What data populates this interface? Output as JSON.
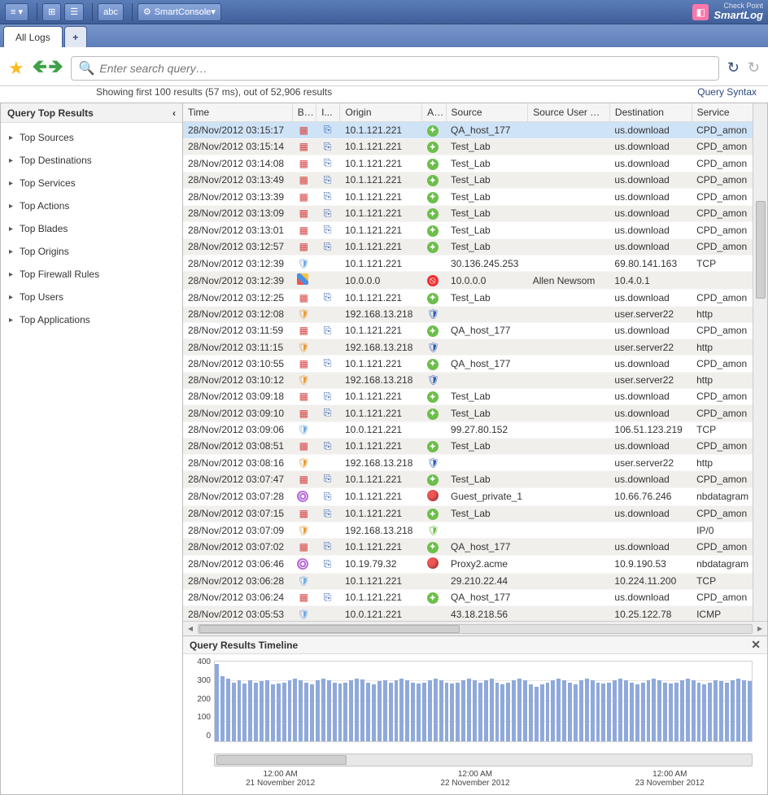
{
  "brand": {
    "top": "Check Point",
    "name": "SmartLog"
  },
  "ribbon": {
    "smartconsole": "SmartConsole",
    "abc": "abc"
  },
  "tabs": {
    "main": "All Logs"
  },
  "search": {
    "placeholder": "Enter search query…"
  },
  "status": {
    "text": "Showing first 100 results (57 ms), out of 52,906 results",
    "syntax": "Query Syntax"
  },
  "left": {
    "header": "Query Top Results",
    "items": [
      "Top Sources",
      "Top Destinations",
      "Top Services",
      "Top Actions",
      "Top Blades",
      "Top Origins",
      "Top Firewall Rules",
      "Top Users",
      "Top Applications"
    ]
  },
  "columns": [
    "Time",
    "B...",
    "I...",
    "Origin",
    "A...",
    "Source",
    "Source User N...",
    "Destination",
    "Service"
  ],
  "rows": [
    {
      "t": "28/Nov/2012 03:15:17",
      "b": "red",
      "i": "log",
      "o": "10.1.121.221",
      "a": "green",
      "s": "QA_host_177",
      "u": "",
      "d": "us.download",
      "v": "CPD_amon",
      "sel": true
    },
    {
      "t": "28/Nov/2012 03:15:14",
      "b": "red",
      "i": "log",
      "o": "10.1.121.221",
      "a": "green",
      "s": "Test_Lab",
      "u": "",
      "d": "us.download",
      "v": "CPD_amon"
    },
    {
      "t": "28/Nov/2012 03:14:08",
      "b": "red",
      "i": "log",
      "o": "10.1.121.221",
      "a": "green",
      "s": "Test_Lab",
      "u": "",
      "d": "us.download",
      "v": "CPD_amon"
    },
    {
      "t": "28/Nov/2012 03:13:49",
      "b": "red",
      "i": "log",
      "o": "10.1.121.221",
      "a": "green",
      "s": "Test_Lab",
      "u": "",
      "d": "us.download",
      "v": "CPD_amon"
    },
    {
      "t": "28/Nov/2012 03:13:39",
      "b": "red",
      "i": "log",
      "o": "10.1.121.221",
      "a": "green",
      "s": "Test_Lab",
      "u": "",
      "d": "us.download",
      "v": "CPD_amon"
    },
    {
      "t": "28/Nov/2012 03:13:09",
      "b": "red",
      "i": "log",
      "o": "10.1.121.221",
      "a": "green",
      "s": "Test_Lab",
      "u": "",
      "d": "us.download",
      "v": "CPD_amon"
    },
    {
      "t": "28/Nov/2012 03:13:01",
      "b": "red",
      "i": "log",
      "o": "10.1.121.221",
      "a": "green",
      "s": "Test_Lab",
      "u": "",
      "d": "us.download",
      "v": "CPD_amon"
    },
    {
      "t": "28/Nov/2012 03:12:57",
      "b": "red",
      "i": "log",
      "o": "10.1.121.221",
      "a": "green",
      "s": "Test_Lab",
      "u": "",
      "d": "us.download",
      "v": "CPD_amon"
    },
    {
      "t": "28/Nov/2012 03:12:39",
      "b": "sh-be",
      "i": "",
      "o": "10.1.121.221",
      "a": "",
      "s": "30.136.245.253",
      "u": "",
      "d": "69.80.141.163",
      "v": "TCP"
    },
    {
      "t": "28/Nov/2012 03:12:39",
      "b": "mix",
      "i": "",
      "o": "10.0.0.0",
      "a": "stop",
      "s": "10.0.0.0",
      "u": "Allen Newsom",
      "d": "10.4.0.1",
      "v": ""
    },
    {
      "t": "28/Nov/2012 03:12:25",
      "b": "red",
      "i": "log",
      "o": "10.1.121.221",
      "a": "green",
      "s": "Test_Lab",
      "u": "",
      "d": "us.download",
      "v": "CPD_amon"
    },
    {
      "t": "28/Nov/2012 03:12:08",
      "b": "sh-o",
      "i": "",
      "o": "192.168.13.218",
      "a": "sh-b",
      "s": "",
      "u": "",
      "d": "user.server22",
      "v": "http"
    },
    {
      "t": "28/Nov/2012 03:11:59",
      "b": "red",
      "i": "log",
      "o": "10.1.121.221",
      "a": "green",
      "s": "QA_host_177",
      "u": "",
      "d": "us.download",
      "v": "CPD_amon"
    },
    {
      "t": "28/Nov/2012 03:11:15",
      "b": "sh-o",
      "i": "",
      "o": "192.168.13.218",
      "a": "sh-b",
      "s": "",
      "u": "",
      "d": "user.server22",
      "v": "http"
    },
    {
      "t": "28/Nov/2012 03:10:55",
      "b": "red",
      "i": "log",
      "o": "10.1.121.221",
      "a": "green",
      "s": "QA_host_177",
      "u": "",
      "d": "us.download",
      "v": "CPD_amon"
    },
    {
      "t": "28/Nov/2012 03:10:12",
      "b": "sh-o",
      "i": "",
      "o": "192.168.13.218",
      "a": "sh-b",
      "s": "",
      "u": "",
      "d": "user.server22",
      "v": "http"
    },
    {
      "t": "28/Nov/2012 03:09:18",
      "b": "red",
      "i": "log",
      "o": "10.1.121.221",
      "a": "green",
      "s": "Test_Lab",
      "u": "",
      "d": "us.download",
      "v": "CPD_amon"
    },
    {
      "t": "28/Nov/2012 03:09:10",
      "b": "red",
      "i": "log",
      "o": "10.1.121.221",
      "a": "green",
      "s": "Test_Lab",
      "u": "",
      "d": "us.download",
      "v": "CPD_amon"
    },
    {
      "t": "28/Nov/2012 03:09:06",
      "b": "sh-be",
      "i": "",
      "o": "10.0.121.221",
      "a": "",
      "s": "99.27.80.152",
      "u": "",
      "d": "106.51.123.219",
      "v": "TCP"
    },
    {
      "t": "28/Nov/2012 03:08:51",
      "b": "red",
      "i": "log",
      "o": "10.1.121.221",
      "a": "green",
      "s": "Test_Lab",
      "u": "",
      "d": "us.download",
      "v": "CPD_amon"
    },
    {
      "t": "28/Nov/2012 03:08:16",
      "b": "sh-o",
      "i": "",
      "o": "192.168.13.218",
      "a": "sh-b",
      "s": "",
      "u": "",
      "d": "user.server22",
      "v": "http"
    },
    {
      "t": "28/Nov/2012 03:07:47",
      "b": "red",
      "i": "log",
      "o": "10.1.121.221",
      "a": "green",
      "s": "Test_Lab",
      "u": "",
      "d": "us.download",
      "v": "CPD_amon"
    },
    {
      "t": "28/Nov/2012 03:07:28",
      "b": "purp",
      "i": "log",
      "o": "10.1.121.221",
      "a": "redc",
      "s": "Guest_private_1",
      "u": "",
      "d": "10.66.76.246",
      "v": "nbdatagram"
    },
    {
      "t": "28/Nov/2012 03:07:15",
      "b": "red",
      "i": "log",
      "o": "10.1.121.221",
      "a": "green",
      "s": "Test_Lab",
      "u": "",
      "d": "us.download",
      "v": "CPD_amon"
    },
    {
      "t": "28/Nov/2012 03:07:09",
      "b": "sh-o",
      "i": "",
      "o": "192.168.13.218",
      "a": "sh-g",
      "s": "",
      "u": "",
      "d": "",
      "v": "IP/0"
    },
    {
      "t": "28/Nov/2012 03:07:02",
      "b": "red",
      "i": "log",
      "o": "10.1.121.221",
      "a": "green",
      "s": "QA_host_177",
      "u": "",
      "d": "us.download",
      "v": "CPD_amon"
    },
    {
      "t": "28/Nov/2012 03:06:46",
      "b": "purp",
      "i": "log",
      "o": "10.19.79.32",
      "a": "redc",
      "s": "Proxy2.acme",
      "u": "",
      "d": "10.9.190.53",
      "v": "nbdatagram"
    },
    {
      "t": "28/Nov/2012 03:06:28",
      "b": "sh-be",
      "i": "",
      "o": "10.1.121.221",
      "a": "",
      "s": "29.210.22.44",
      "u": "",
      "d": "10.224.11.200",
      "v": "TCP"
    },
    {
      "t": "28/Nov/2012 03:06:24",
      "b": "red",
      "i": "log",
      "o": "10.1.121.221",
      "a": "green",
      "s": "QA_host_177",
      "u": "",
      "d": "us.download",
      "v": "CPD_amon"
    },
    {
      "t": "28/Nov/2012 03:05:53",
      "b": "sh-be",
      "i": "",
      "o": "10.0.121.221",
      "a": "",
      "s": "43.18.218.56",
      "u": "",
      "d": "10.25.122.78",
      "v": "ICMP"
    }
  ],
  "timeline": {
    "header": "Query Results Timeline",
    "chart_data": {
      "type": "bar",
      "title": "",
      "xlabel": "",
      "ylabel": "",
      "ylim": [
        0,
        400
      ],
      "yticks": [
        0,
        100,
        200,
        300,
        400
      ],
      "xlabels": [
        {
          "t1": "12:00 AM",
          "t2": "21 November 2012"
        },
        {
          "t1": "12:00 AM",
          "t2": "22 November 2012"
        },
        {
          "t1": "12:00 AM",
          "t2": "23 November 2012"
        }
      ],
      "values": [
        380,
        320,
        310,
        290,
        300,
        285,
        300,
        290,
        295,
        300,
        280,
        285,
        290,
        300,
        310,
        300,
        290,
        280,
        300,
        310,
        300,
        290,
        285,
        290,
        300,
        310,
        305,
        290,
        280,
        295,
        300,
        290,
        300,
        310,
        300,
        290,
        285,
        290,
        300,
        310,
        300,
        290,
        285,
        290,
        300,
        310,
        300,
        290,
        300,
        310,
        290,
        280,
        290,
        300,
        310,
        300,
        280,
        270,
        280,
        290,
        300,
        310,
        300,
        290,
        280,
        300,
        310,
        300,
        290,
        285,
        290,
        300,
        310,
        300,
        290,
        280,
        290,
        300,
        310,
        300,
        290,
        285,
        290,
        300,
        310,
        300,
        290,
        280,
        290,
        300,
        295,
        290,
        300,
        310,
        300,
        295
      ]
    }
  }
}
